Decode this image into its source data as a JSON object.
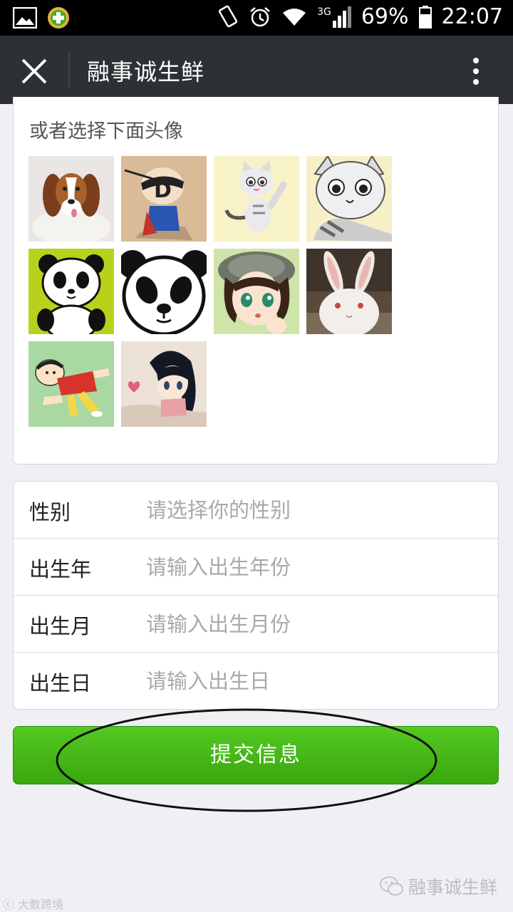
{
  "status_bar": {
    "battery": "69%",
    "time": "22:07",
    "network": "3G",
    "icons": [
      "gallery-icon",
      "app-badge-icon",
      "vibrate-icon",
      "alarm-icon",
      "wifi-icon",
      "signal-icon",
      "battery-icon"
    ]
  },
  "navbar": {
    "title": "融事诚生鲜",
    "icons": [
      "close-icon",
      "more-icon"
    ]
  },
  "avatar_section": {
    "title": "或者选择下面头像",
    "avatars": [
      "beagle-puppy",
      "masked-superhero-cartoon",
      "chi-cat-waving",
      "chi-cat-face",
      "panda-cartoon-green",
      "panda-face",
      "cartoon-girl-hat",
      "white-rabbit",
      "crayon-shin-chan",
      "cartoon-girl-heart"
    ]
  },
  "form": {
    "rows": [
      {
        "label": "性别",
        "placeholder": "请选择你的性别"
      },
      {
        "label": "出生年",
        "placeholder": "请输入出生年份"
      },
      {
        "label": "出生月",
        "placeholder": "请输入出生月份"
      },
      {
        "label": "出生日",
        "placeholder": "请输入出生日"
      }
    ]
  },
  "submit": {
    "label": "提交信息"
  },
  "watermark": {
    "right": "融事诚生鲜",
    "left": "大数跨境"
  },
  "colors": {
    "primary_green": "#44b71a",
    "navbar": "#2d3134"
  }
}
